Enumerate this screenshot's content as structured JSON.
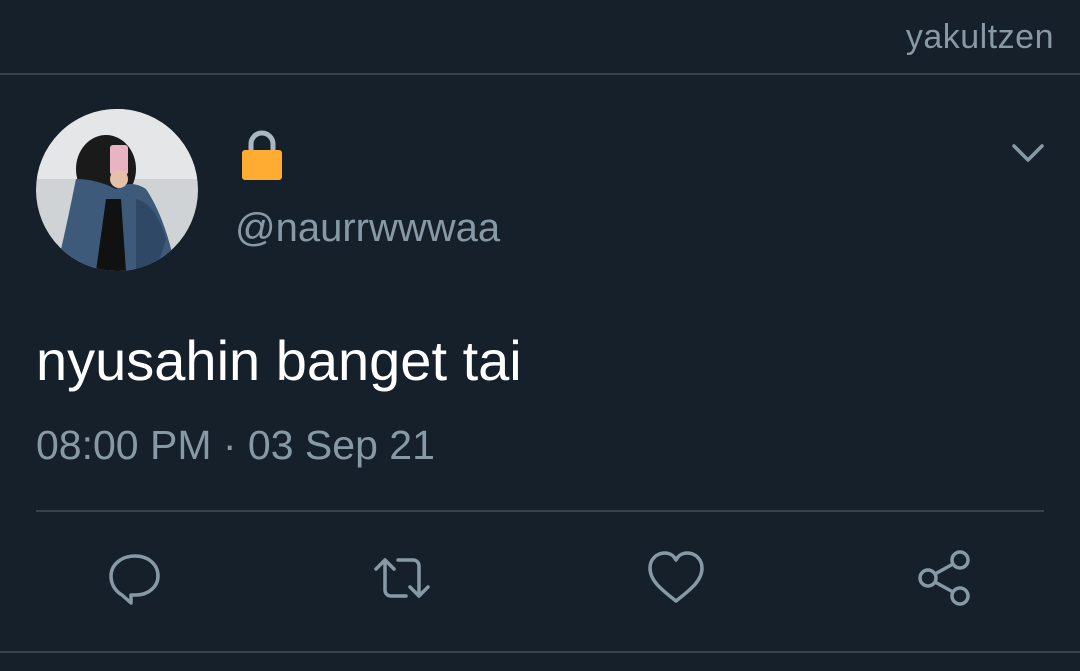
{
  "watermark": "yakultzen",
  "tweet": {
    "handle": "@naurrwwwaa",
    "text": "nyusahin banget tai",
    "timestamp": "08:00 PM · 03 Sep 21",
    "protected_icon": "lock-icon",
    "menu_icon": "chevron-down-icon"
  },
  "actions": [
    {
      "name": "reply",
      "icon": "reply-icon"
    },
    {
      "name": "retweet",
      "icon": "retweet-icon"
    },
    {
      "name": "like",
      "icon": "heart-icon"
    },
    {
      "name": "share",
      "icon": "share-icon"
    }
  ],
  "colors": {
    "background": "#15202b",
    "secondary_text": "#8899a6",
    "divider": "#38444d",
    "lock": "#ffac33"
  }
}
